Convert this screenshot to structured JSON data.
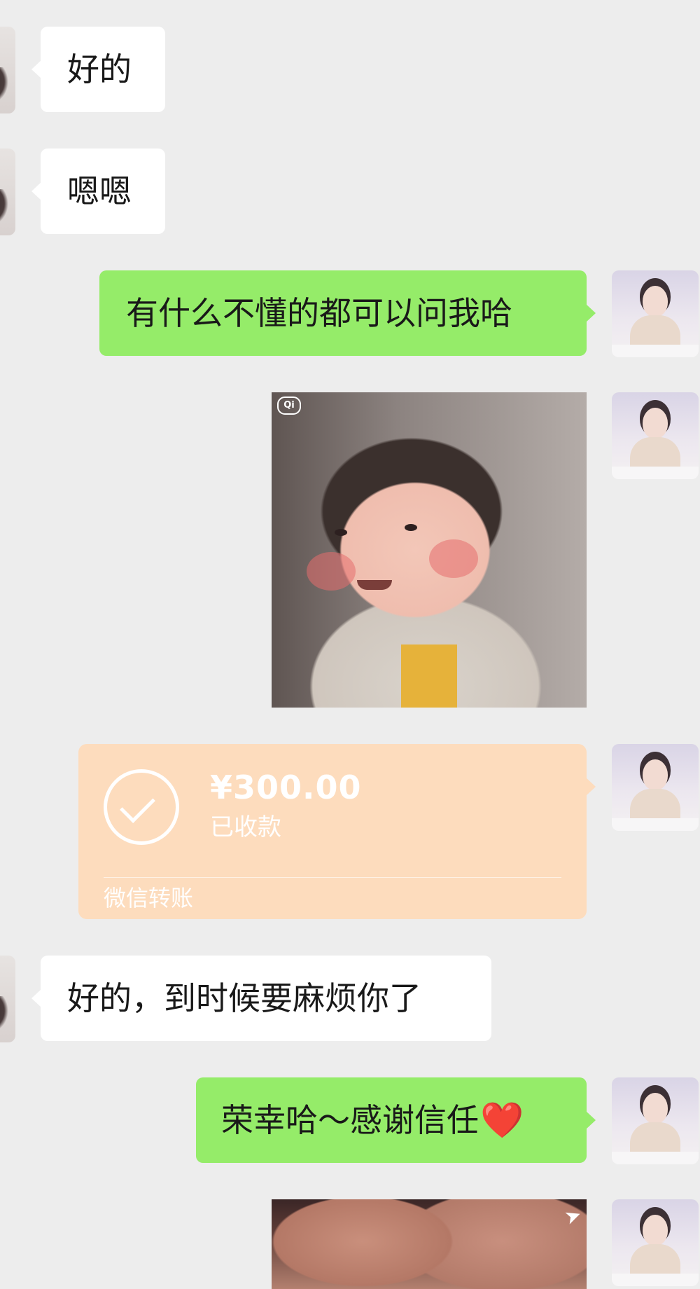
{
  "messages": [
    {
      "side": "in",
      "type": "text",
      "text": "好的"
    },
    {
      "side": "in",
      "type": "text",
      "text": "嗯嗯"
    },
    {
      "side": "out",
      "type": "text",
      "text": "有什么不懂的都可以问我哈"
    },
    {
      "side": "out",
      "type": "sticker"
    },
    {
      "side": "out",
      "type": "transfer",
      "amount": "¥300.00",
      "status": "已收款",
      "label": "微信转账"
    },
    {
      "side": "in",
      "type": "text",
      "text": "好的，到时候要麻烦你了"
    },
    {
      "side": "out",
      "type": "text",
      "text": "荣幸哈～感谢信任",
      "emoji": "❤️"
    },
    {
      "side": "out",
      "type": "sticker"
    }
  ],
  "colors": {
    "background": "#ededed",
    "incoming_bubble": "#ffffff",
    "outgoing_bubble": "#95ec69",
    "transfer_card": "#fddcbd"
  }
}
